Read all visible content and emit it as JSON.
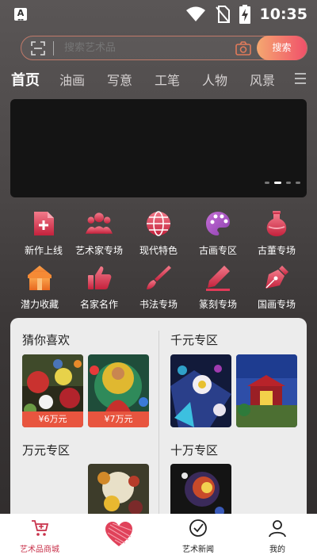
{
  "status_bar": {
    "time": "10:35",
    "icons": [
      "notification-a-icon",
      "wifi-icon",
      "no-sim-icon",
      "battery-charging-icon"
    ]
  },
  "search": {
    "placeholder": "搜索艺术品",
    "button_label": "搜索"
  },
  "tabs": [
    {
      "label": "首页",
      "active": true
    },
    {
      "label": "油画"
    },
    {
      "label": "写意"
    },
    {
      "label": "工笔"
    },
    {
      "label": "人物"
    },
    {
      "label": "风景"
    }
  ],
  "banner": {
    "dots": 4,
    "active_dot": 1
  },
  "categories": [
    {
      "label": "新作上线",
      "icon": "new-doc-icon"
    },
    {
      "label": "艺术家专场",
      "icon": "people-icon"
    },
    {
      "label": "现代特色",
      "icon": "globe-icon"
    },
    {
      "label": "古画专区",
      "icon": "palette-icon"
    },
    {
      "label": "古董专场",
      "icon": "vase-icon"
    },
    {
      "label": "潜力收藏",
      "icon": "gift-box-icon"
    },
    {
      "label": "名家名作",
      "icon": "thumbs-up-icon"
    },
    {
      "label": "书法专场",
      "icon": "brush-icon"
    },
    {
      "label": "篆刻专场",
      "icon": "pen-icon"
    },
    {
      "label": "国画专场",
      "icon": "fountain-pen-icon"
    }
  ],
  "sections": {
    "guess": {
      "title": "猜你喜欢",
      "prices": [
        "¥6万元",
        "¥7万元"
      ]
    },
    "qianyuan": {
      "title": "千元专区"
    },
    "wanyuan": {
      "title": "万元专区"
    },
    "shiwan": {
      "title": "十万专区"
    }
  },
  "bottom_nav": [
    {
      "label": "艺术品商城",
      "icon": "cart-icon",
      "active": true
    },
    {
      "label": "",
      "icon": "heart-icon"
    },
    {
      "label": "艺术新闻",
      "icon": "check-circle-icon"
    },
    {
      "label": "我的",
      "icon": "user-icon"
    }
  ],
  "colors": {
    "accent": "#e8553f",
    "icon_gradient_start": "#f27a8a",
    "icon_gradient_end": "#c4213c",
    "search_button_start": "#f5a870",
    "search_button_end": "#f0506a",
    "nav_active": "#c8314a"
  }
}
